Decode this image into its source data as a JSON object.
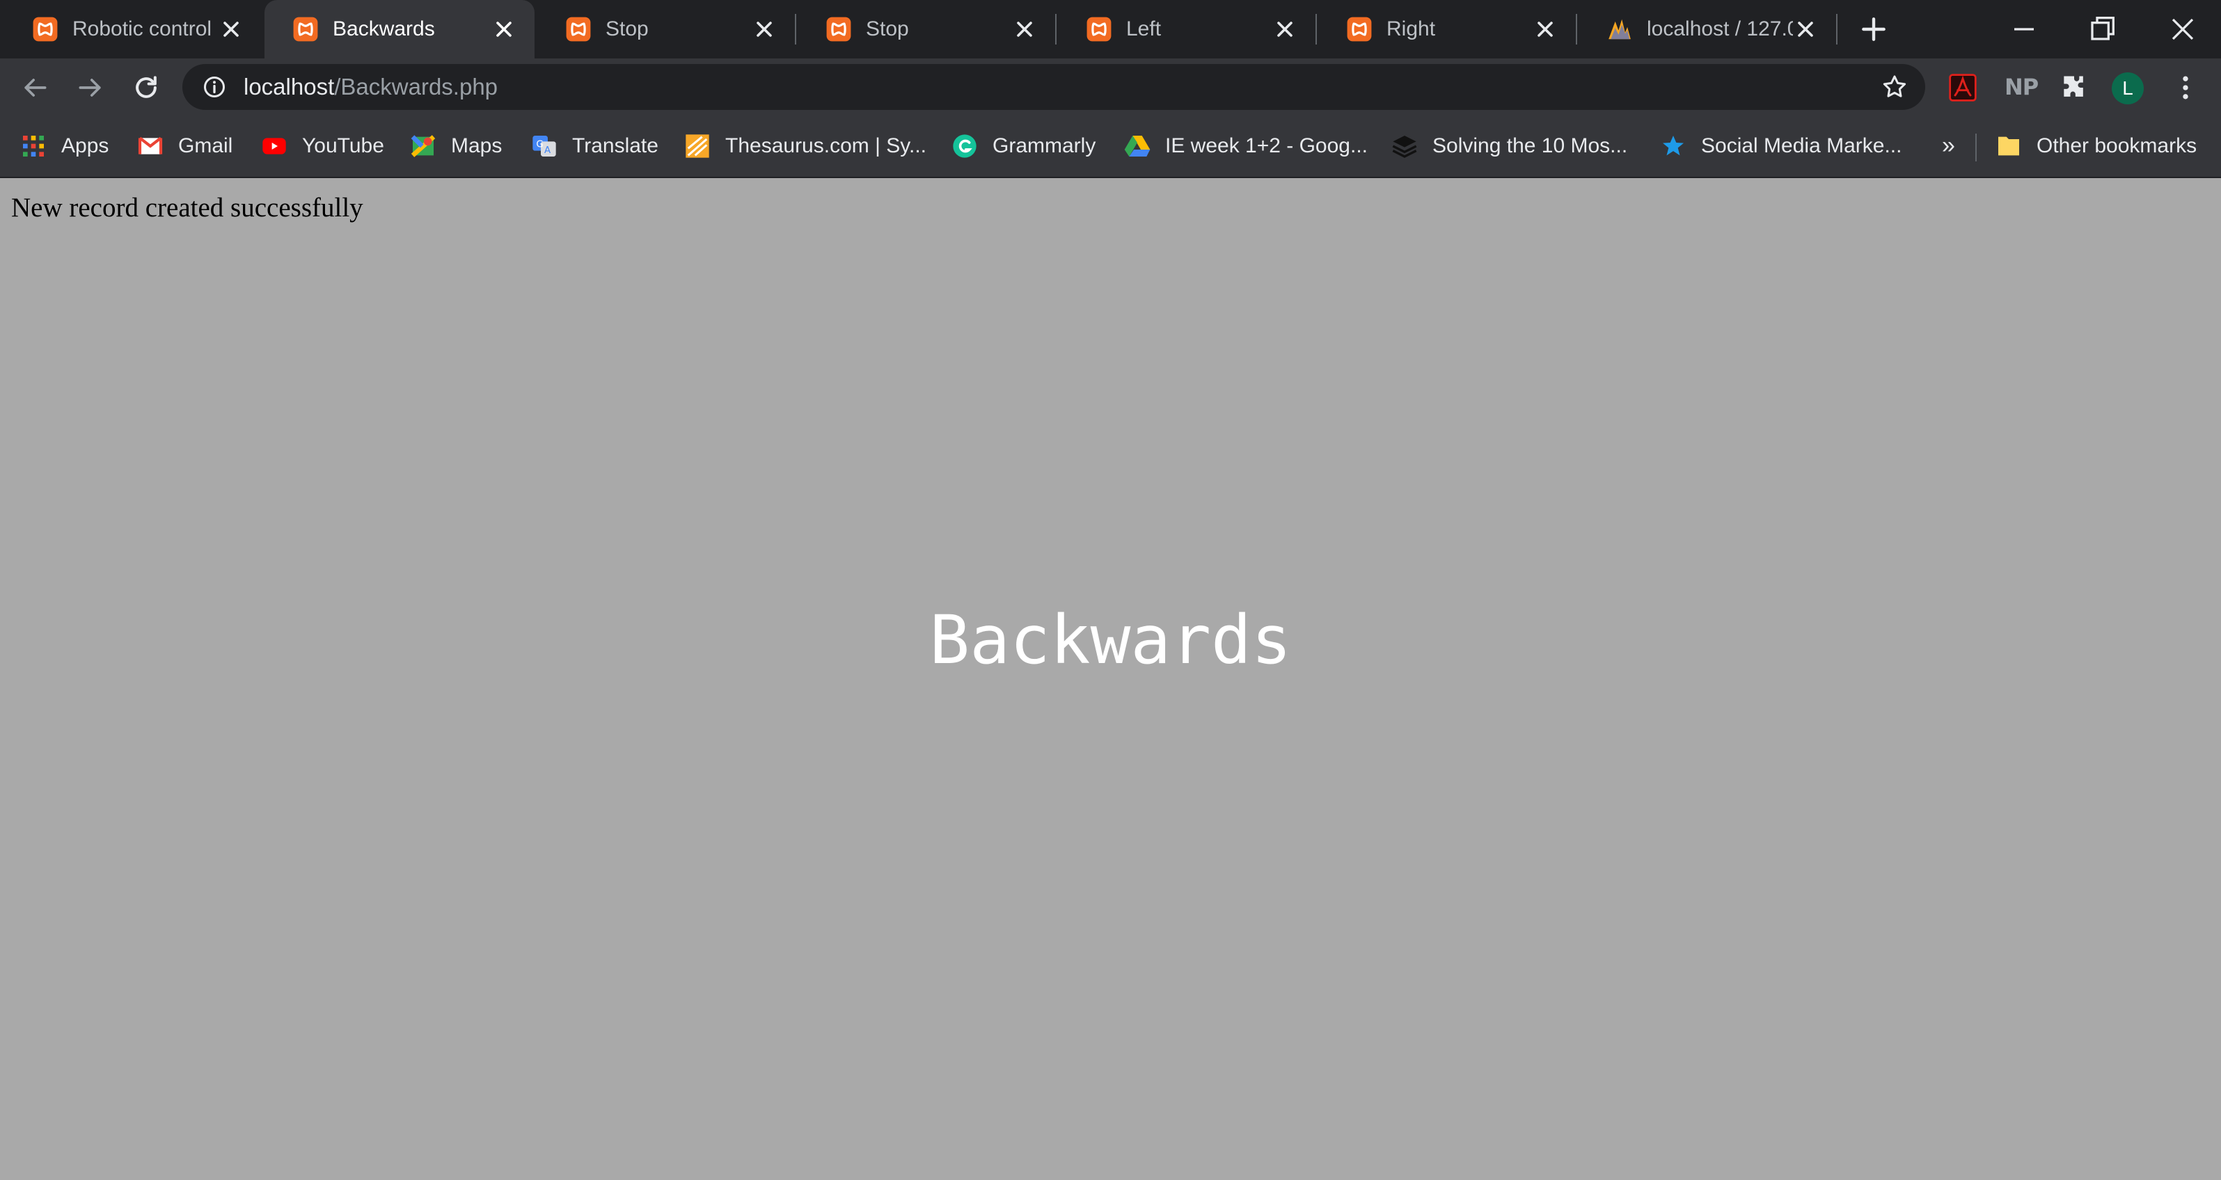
{
  "browser": {
    "tabs": [
      {
        "title": "Robotic control",
        "icon": "xampp-icon",
        "active": false
      },
      {
        "title": "Backwards",
        "icon": "xampp-icon",
        "active": true
      },
      {
        "title": "Stop",
        "icon": "xampp-icon",
        "active": false
      },
      {
        "title": "Stop",
        "icon": "xampp-icon",
        "active": false
      },
      {
        "title": "Left",
        "icon": "xampp-icon",
        "active": false
      },
      {
        "title": "Right",
        "icon": "xampp-icon",
        "active": false
      },
      {
        "title": "localhost / 127.0",
        "icon": "phpmyadmin-icon",
        "active": false
      }
    ],
    "address_bar": {
      "host": "localhost",
      "path": "/Backwards.php"
    },
    "extensions": {
      "np_label": "NP",
      "profile_initial": "L"
    },
    "bookmarks": [
      {
        "label": "Apps",
        "icon": "apps-grid-icon"
      },
      {
        "label": "Gmail",
        "icon": "gmail-icon"
      },
      {
        "label": "YouTube",
        "icon": "youtube-icon"
      },
      {
        "label": "Maps",
        "icon": "maps-icon"
      },
      {
        "label": "Translate",
        "icon": "translate-icon"
      },
      {
        "label": "Thesaurus.com | Sy...",
        "icon": "thesaurus-icon"
      },
      {
        "label": "Grammarly",
        "icon": "grammarly-icon"
      },
      {
        "label": "IE week 1+2 - Goog...",
        "icon": "google-drive-icon"
      },
      {
        "label": "Solving the 10 Mos...",
        "icon": "layers-icon"
      },
      {
        "label": "Social Media Marke...",
        "icon": "star-logo-icon"
      }
    ],
    "bookmarks_overflow": "»",
    "other_bookmarks": "Other bookmarks"
  },
  "page": {
    "message": "New record created successfully",
    "heading": "Backwards"
  },
  "colors": {
    "page_background": "#a9a9a9",
    "heading_color": "#ffffff",
    "xampp_orange": "#f26b22"
  }
}
